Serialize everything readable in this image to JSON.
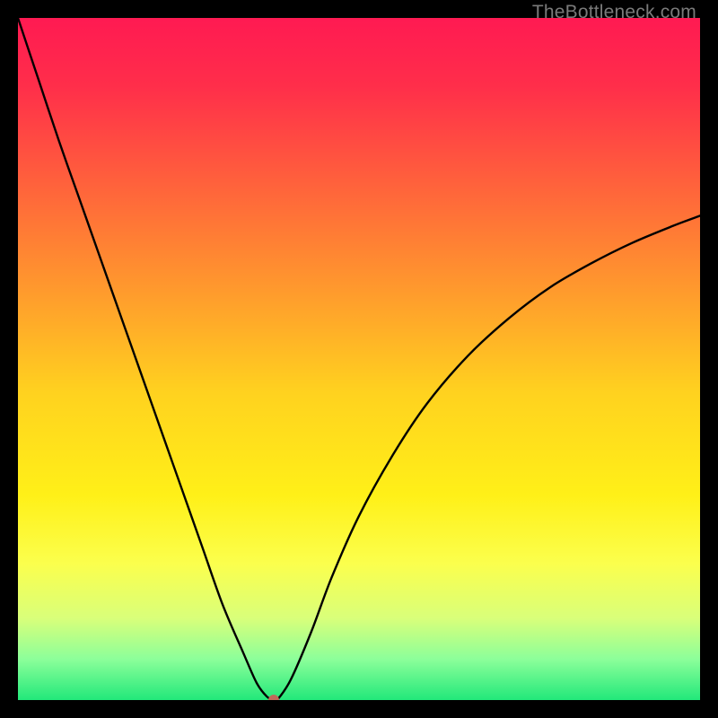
{
  "watermark": "TheBottleneck.com",
  "chart_data": {
    "type": "line",
    "title": "",
    "xlabel": "",
    "ylabel": "",
    "xlim": [
      0,
      100
    ],
    "ylim": [
      0,
      100
    ],
    "grid": false,
    "legend": false,
    "gradient_stops": [
      {
        "offset": 0.0,
        "color": "#ff1a52"
      },
      {
        "offset": 0.1,
        "color": "#ff2e4a"
      },
      {
        "offset": 0.25,
        "color": "#ff643b"
      },
      {
        "offset": 0.4,
        "color": "#ff9a2d"
      },
      {
        "offset": 0.55,
        "color": "#ffd21f"
      },
      {
        "offset": 0.7,
        "color": "#fff018"
      },
      {
        "offset": 0.8,
        "color": "#fbff4d"
      },
      {
        "offset": 0.88,
        "color": "#d9ff7a"
      },
      {
        "offset": 0.94,
        "color": "#8cff9a"
      },
      {
        "offset": 1.0,
        "color": "#22e87a"
      }
    ],
    "series": [
      {
        "name": "bottleneck-curve",
        "x": [
          0,
          3,
          6,
          9,
          12,
          15,
          18,
          21,
          24,
          27,
          30,
          33,
          35,
          36.5,
          37.5,
          38,
          40,
          43,
          46,
          50,
          55,
          60,
          66,
          72,
          78,
          84,
          90,
          96,
          100
        ],
        "y": [
          100,
          91,
          82,
          73.5,
          65,
          56.5,
          48,
          39.5,
          31,
          22.5,
          14,
          7,
          2.5,
          0.5,
          0,
          0,
          3,
          10,
          18,
          27,
          36,
          43.5,
          50.5,
          56,
          60.5,
          64,
          67,
          69.5,
          71
        ]
      }
    ],
    "marker": {
      "x": 37.5,
      "y": 0,
      "color": "#c06a5a",
      "r": 6
    }
  }
}
